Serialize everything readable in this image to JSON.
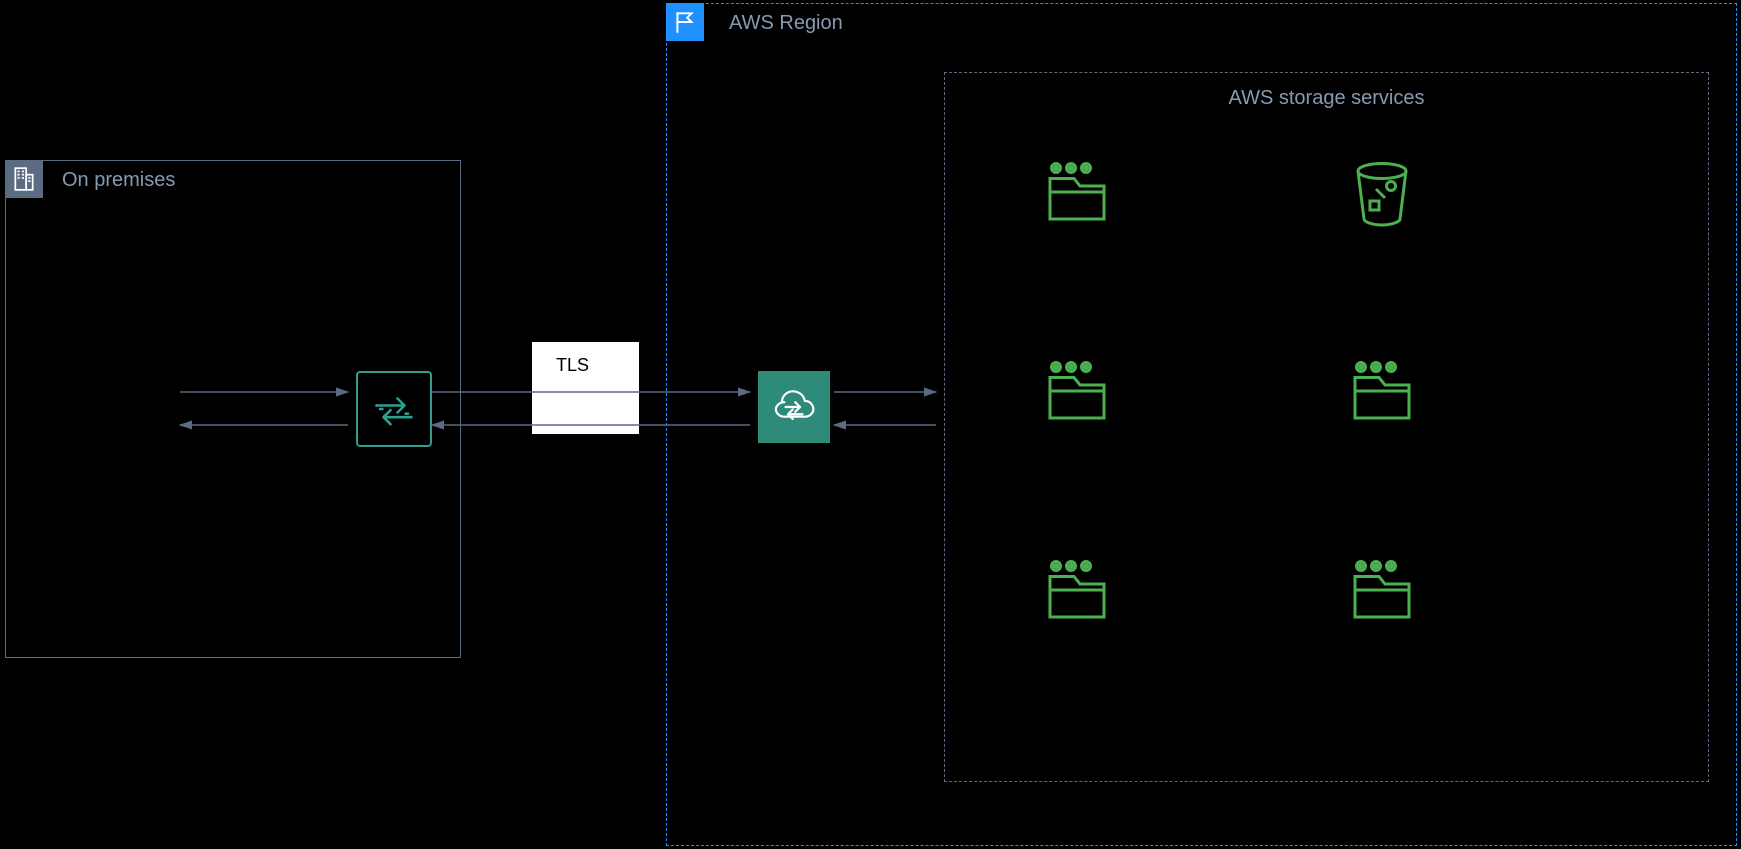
{
  "onprem": {
    "label": "On premises"
  },
  "region": {
    "label": "AWS Region"
  },
  "storage": {
    "label": "AWS storage services"
  },
  "tls": {
    "label": "TLS"
  },
  "colors": {
    "onprem_border": "#5a6b82",
    "region_border": "#1e90ff",
    "storage_border": "#5a6b82",
    "service_green": "#4caf50",
    "datasync_teal": "#2e8b7a",
    "label_text": "#879ab2",
    "arrow": "#5a6b82"
  },
  "nodes": {
    "agent": "datasync-agent",
    "datasync": "aws-datasync",
    "services": [
      "fsx-windows",
      "s3",
      "efs",
      "fsx-lustre",
      "fsx-ontap",
      "fsx-openzfs"
    ]
  },
  "flows": [
    {
      "from": "source",
      "to": "agent",
      "dir": "both"
    },
    {
      "from": "agent",
      "to": "datasync",
      "dir": "both",
      "via": "TLS"
    },
    {
      "from": "datasync",
      "to": "storage-services",
      "dir": "both"
    }
  ]
}
